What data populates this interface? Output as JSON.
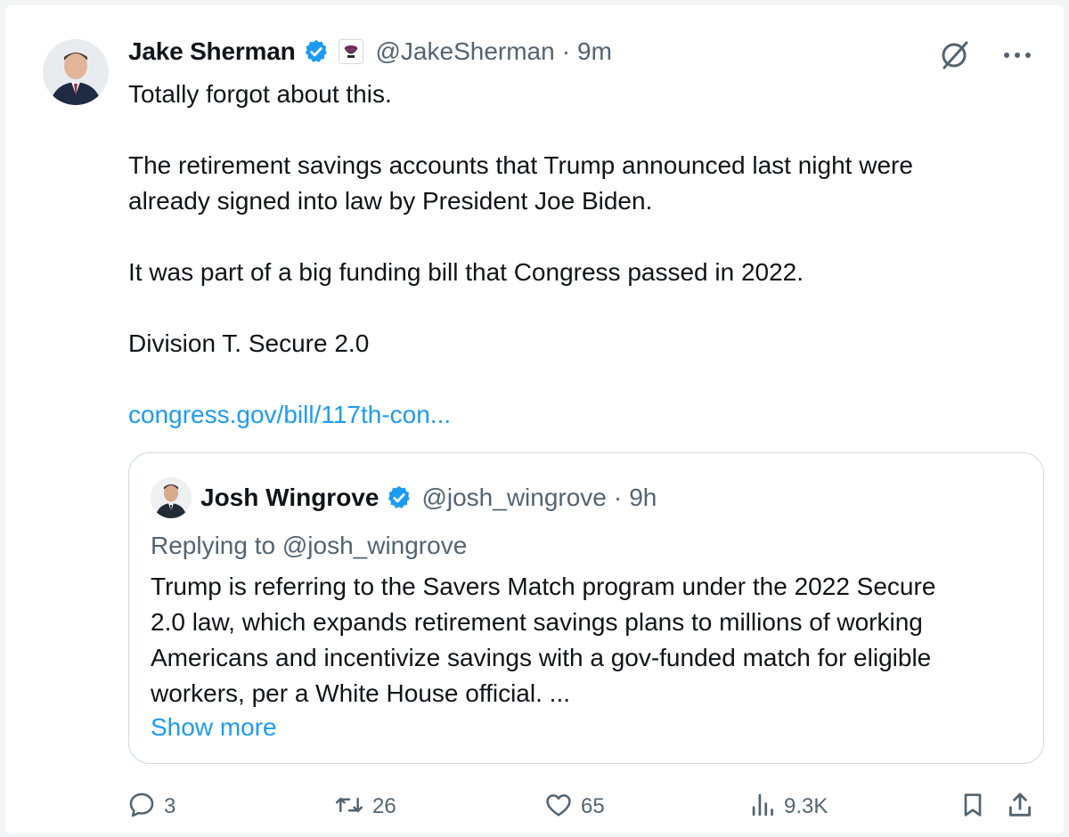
{
  "tweet": {
    "author_name": "Jake Sherman",
    "handle": "@JakeSherman",
    "separator": "·",
    "time": "9m",
    "lines": [
      "Totally forgot about this.",
      "The retirement savings accounts that Trump announced last night were",
      "already signed into law by President Joe Biden.",
      "It was part of a big funding bill that Congress passed in 2022.",
      "Division T. Secure 2.0"
    ],
    "link_text": "congress.gov/bill/117th-con..."
  },
  "quoted": {
    "author_name": "Josh Wingrove",
    "handle": "@josh_wingrove",
    "separator": "·",
    "time": "9h",
    "replying_to": "Replying to @josh_wingrove",
    "lines": [
      "Trump is referring to the Savers Match program under the 2022 Secure",
      "2.0 law, which expands retirement savings plans to millions of working",
      "Americans and incentivize savings with a gov-funded match for eligible",
      "workers, per a White House official. ..."
    ],
    "show_more": "Show more"
  },
  "metrics": {
    "replies": "3",
    "reposts": "26",
    "likes": "65",
    "views": "9.3K"
  },
  "icons": {
    "verified": "verified-badge-icon",
    "affiliation": "affiliation-badge-icon",
    "grok": "grok-icon",
    "more": "more-options-icon",
    "reply": "reply-icon",
    "repost": "repost-icon",
    "like": "heart-icon",
    "views": "views-icon",
    "bookmark": "bookmark-icon",
    "share": "share-icon"
  },
  "colors": {
    "accent": "#1d9bf0",
    "text": "#0f1419",
    "muted": "#536471",
    "border": "#cfd9de"
  }
}
